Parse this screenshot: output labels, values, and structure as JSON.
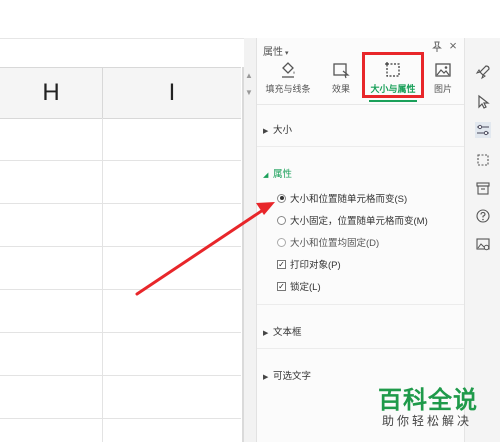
{
  "sheet": {
    "columns": [
      "H",
      "I"
    ]
  },
  "panel": {
    "title": "属性",
    "tabs": [
      {
        "label": "填充与线条",
        "icon": "fill-bucket-icon"
      },
      {
        "label": "效果",
        "icon": "effect-icon"
      },
      {
        "label": "大小与属性",
        "icon": "size-frame-icon",
        "active": true
      },
      {
        "label": "图片",
        "icon": "image-icon"
      }
    ],
    "sections": {
      "size": "大小",
      "properties": "属性",
      "textbox": "文本框",
      "alt_text": "可选文字"
    },
    "options": {
      "move_size_with_cells": "大小和位置随单元格而变(S)",
      "fixed_size_move_with_cells": "大小固定，位置随单元格而变(M)",
      "fixed_size_and_position": "大小和位置均固定(D)",
      "print_object": "打印对象(P)",
      "locked": "锁定(L)"
    },
    "state": {
      "selected_radio": "move_size_with_cells",
      "print_object_checked": true,
      "locked_checked": true
    }
  },
  "toolstrip": {
    "icons": [
      "rocket-icon",
      "cursor-icon",
      "sliders-icon",
      "crop-frame-icon",
      "archive-icon",
      "help-icon",
      "image-settings-icon"
    ]
  },
  "colors": {
    "accent_green": "#1aa05a",
    "highlight_red": "#e8262a",
    "watermark_green": "#1f9a4a"
  },
  "watermark": {
    "main": "百科全说",
    "sub": "助你轻松解决"
  }
}
